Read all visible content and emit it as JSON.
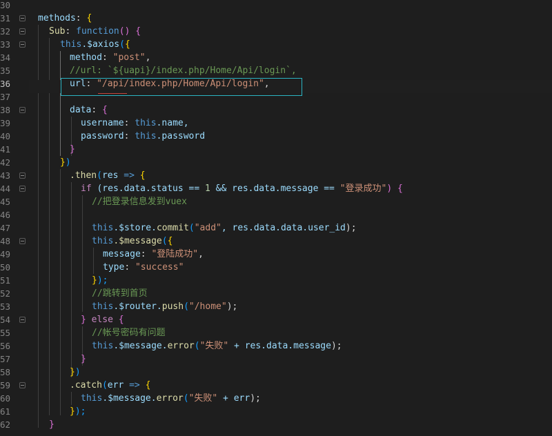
{
  "gutter": {
    "line_numbers": [
      "30",
      "31",
      "32",
      "33",
      "34",
      "35",
      "36",
      "37",
      "38",
      "39",
      "40",
      "41",
      "42",
      "43",
      "44",
      "45",
      "46",
      "47",
      "48",
      "49",
      "50",
      "51",
      "52",
      "53",
      "54",
      "55",
      "56",
      "57",
      "58",
      "59",
      "60",
      "61",
      "62"
    ],
    "active_line": "36"
  },
  "code": {
    "l31": {
      "methods": "methods",
      "colon": ":",
      "brace": "{"
    },
    "l32": {
      "sub": "Sub",
      "colon": ":",
      "function": "function",
      "paren": "()",
      "brace": "{"
    },
    "l33": {
      "this": "this",
      "axios": ".$axios",
      "open": "(",
      "brace": "{"
    },
    "l34": {
      "method": "method",
      "colon": ":",
      "value": "\"post\"",
      "comma": ","
    },
    "l35": {
      "comment": "//url: `${uapi}/index.php/Home/Api/login`,"
    },
    "l36": {
      "url": "url",
      "colon": ":",
      "value": "\"/api/index.php/Home/Api/login\"",
      "comma": ","
    },
    "l38": {
      "data": "data",
      "colon": ":",
      "brace": "{"
    },
    "l39": {
      "username": "username",
      "colon": ":",
      "this": "this",
      "rest": ".name,"
    },
    "l40": {
      "password": "password",
      "colon": ":",
      "this": "this",
      "rest": ".password"
    },
    "l41": {
      "brace": "}"
    },
    "l42": {
      "brace": "}",
      "paren": ")"
    },
    "l43": {
      "then": ".then",
      "open": "(",
      "res": "res",
      "arrow": "=>",
      "brace": "{"
    },
    "l44": {
      "if": "if",
      "cond1": "(res.data.status == ",
      "one": "1",
      "and": " && res.data.message == ",
      "str": "\"登录成功\"",
      "close": ")",
      "brace": "{"
    },
    "l45": {
      "comment": "//把登录信息发到vuex"
    },
    "l47": {
      "this": "this",
      "store": ".$store.",
      "commit": "commit",
      "open": "(",
      "str": "\"add\"",
      "rest": ", res.data.data.user_id",
      "close": ");"
    },
    "l48": {
      "this": "this",
      "message": ".$message",
      "open": "(",
      "brace": "{"
    },
    "l49": {
      "key": "message",
      "colon": ":",
      "str": "\"登陆成功\"",
      "comma": ","
    },
    "l50": {
      "key": "type",
      "colon": ":",
      "str": "\"success\""
    },
    "l51": {
      "brace": "}",
      "close": ");"
    },
    "l52": {
      "comment": "//跳转到首页"
    },
    "l53": {
      "this": "this",
      "router": ".$router.",
      "push": "push",
      "open": "(",
      "str": "\"/home\"",
      "close": ");"
    },
    "l54": {
      "brace": "}",
      "else": "else",
      "brace2": "{"
    },
    "l55": {
      "comment": "//帐号密码有问题"
    },
    "l56": {
      "this": "this",
      "message": ".$message.",
      "error": "error",
      "open": "(",
      "str": "\"失败\"",
      "rest": " + res.data.message",
      "close": ");"
    },
    "l57": {
      "brace": "}"
    },
    "l58": {
      "brace": "}",
      "paren": ")"
    },
    "l59": {
      "catch": ".catch",
      "open": "(",
      "err": "err",
      "arrow": "=>",
      "brace": "{"
    },
    "l60": {
      "this": "this",
      "message": ".$message.",
      "error": "error",
      "open": "(",
      "str": "\"失败\"",
      "rest": " + err",
      "close": ");"
    },
    "l61": {
      "brace": "}",
      "close": ");"
    },
    "l62": {
      "brace": "}"
    }
  },
  "colors": {
    "background": "#1e1e1e",
    "keyword": "#569cd6",
    "string": "#ce9178",
    "comment": "#6a9955",
    "property": "#9cdcfe",
    "function": "#dcdcaa",
    "control": "#c586c0",
    "highlight_box": "#2bb5c4",
    "squiggle": "#c6453b"
  }
}
